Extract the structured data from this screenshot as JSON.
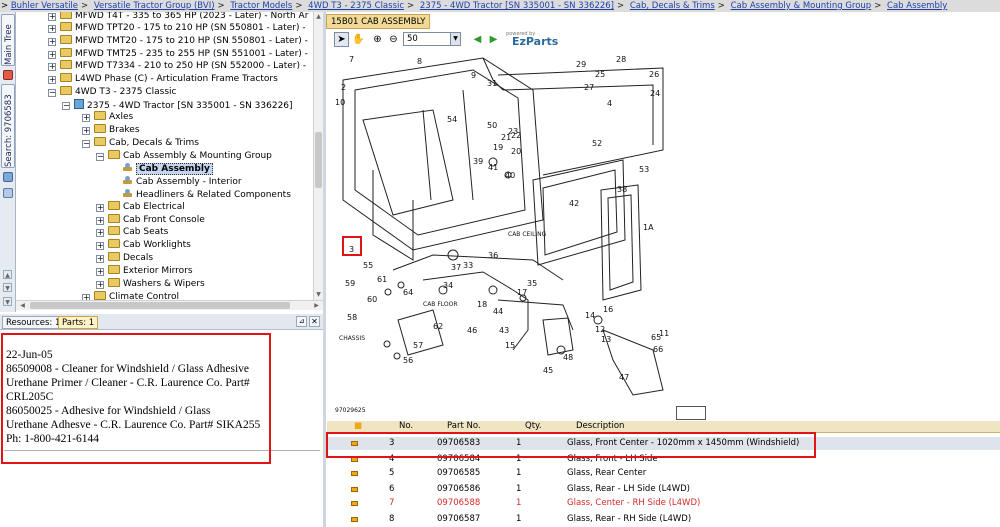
{
  "breadcrumb": {
    "items": [
      "Buhler Versatile",
      "Versatile Tractor Group (BVI)",
      "Tractor Models",
      "4WD T3 - 2375 Classic",
      "2375 - 4WD Tractor [SN 335001 - SN 336226]",
      "Cab, Decals & Trims",
      "Cab Assembly & Mounting Group",
      "Cab Assembly"
    ],
    "separator": ">"
  },
  "side_tabs": {
    "main_tree": "Main Tree",
    "search": "Search: 9706583"
  },
  "tree": {
    "nodes": [
      {
        "text": "MFWD T4T - 335 to 365 HP (2023 - Later) - North Ar",
        "icon": "folder-icon"
      },
      {
        "text": "MFWD TPT20 - 175 to 210 HP (SN 550801 - Later) -",
        "icon": "folder-icon"
      },
      {
        "text": "MFWD TMT20 - 175 to 210 HP (SN 550801 - Later) -",
        "icon": "folder-icon"
      },
      {
        "text": "MFWD TMT25 - 235 to 255 HP (SN 551001 - Later) -",
        "icon": "folder-icon"
      },
      {
        "text": "MFWD T7334 - 210 to 250 HP (SN 552000 - Later) -",
        "icon": "folder-icon"
      },
      {
        "text": "L4WD Phase (C) - Articulation Frame Tractors",
        "icon": "folder-icon"
      },
      {
        "text": "4WD T3 - 2375 Classic",
        "icon": "folder-icon"
      },
      {
        "text": "2375 - 4WD Tractor [SN 335001 - SN 336226]",
        "icon": "document-icon"
      },
      {
        "text": "Axles",
        "icon": "folder-icon"
      },
      {
        "text": "Brakes",
        "icon": "folder-icon"
      },
      {
        "text": "Cab, Decals & Trims",
        "icon": "folder-icon"
      },
      {
        "text": "Cab Assembly & Mounting Group",
        "icon": "folder-icon"
      },
      {
        "text": "Cab Assembly",
        "icon": "picture-icon",
        "selected": true
      },
      {
        "text": "Cab Assembly - Interior",
        "icon": "picture-icon"
      },
      {
        "text": "Headliners & Related Components",
        "icon": "picture-icon"
      },
      {
        "text": "Cab Electrical",
        "icon": "folder-icon"
      },
      {
        "text": "Cab Front Console",
        "icon": "folder-icon"
      },
      {
        "text": "Cab Seats",
        "icon": "folder-icon"
      },
      {
        "text": "Cab Worklights",
        "icon": "folder-icon"
      },
      {
        "text": "Decals",
        "icon": "folder-icon"
      },
      {
        "text": "Exterior Mirrors",
        "icon": "folder-icon"
      },
      {
        "text": "Washers & Wipers",
        "icon": "folder-icon"
      },
      {
        "text": "Climate Control",
        "icon": "folder-icon"
      }
    ]
  },
  "bottom_tabs": {
    "resources": "Resources: 1",
    "parts": "Parts: 1"
  },
  "notes": {
    "lines": [
      "22-Jun-05",
      "86509008 - Cleaner for Windshield / Glass Adhesive",
      "Urethane Primer / Cleaner - C.R. Laurence Co. Part#",
      "CRL205C",
      "86050025 - Adhesive for Windshield / Glass",
      "Urethane Adhesve - C.R. Laurence Co. Part# SIKA255",
      "Ph: 1-800-421-6144"
    ]
  },
  "diagram_tab": {
    "label": "15B01 CAB ASSEMBLY"
  },
  "toolbar": {
    "zoom": "50",
    "brand_small": "powered by",
    "brand": "EzParts"
  },
  "diagram": {
    "code": "97029625",
    "callouts": [
      "7",
      "8",
      "2",
      "10",
      "3",
      "9",
      "31",
      "54",
      "50",
      "19",
      "21",
      "39",
      "41",
      "40",
      "20",
      "23",
      "28",
      "29",
      "25",
      "27",
      "26",
      "24",
      "4",
      "22",
      "52",
      "53",
      "38",
      "42",
      "1A",
      "36",
      "37",
      "35",
      "59",
      "61",
      "60",
      "64",
      "34",
      "33",
      "18",
      "17",
      "16",
      "14",
      "12",
      "11",
      "13",
      "15",
      "44",
      "43",
      "45",
      "46",
      "58",
      "62",
      "57",
      "56",
      "55",
      "65",
      "66",
      "48",
      "47"
    ],
    "labels": {
      "cab_ceiling": "CAB CEILING",
      "cab_floor": "CAB FLOOR",
      "chassis": "CHASSIS"
    },
    "highlighted_callout": "3"
  },
  "parts_table": {
    "headers": [
      "No.",
      "Part No.",
      "Qty.",
      "Description"
    ],
    "rows": [
      {
        "no": "3",
        "part": "09706583",
        "qty": "1",
        "desc": "Glass, Front Center - 1020mm x 1450mm (Windshield)",
        "highlight": true
      },
      {
        "no": "4",
        "part": "09706584",
        "qty": "1",
        "desc": "Glass, Front - LH Side"
      },
      {
        "no": "5",
        "part": "09706585",
        "qty": "1",
        "desc": "Glass, Rear Center"
      },
      {
        "no": "6",
        "part": "09706586",
        "qty": "1",
        "desc": "Glass, Rear - LH Side (L4WD)"
      },
      {
        "no": "7",
        "part": "09706588",
        "qty": "1",
        "desc": "Glass, Center - RH Side (L4WD)",
        "red": true
      },
      {
        "no": "8",
        "part": "09706587",
        "qty": "1",
        "desc": "Glass, Rear - RH Side (L4WD)"
      }
    ]
  },
  "colors": {
    "accent_red": "#e01414",
    "link_blue": "#1f3fa8",
    "tab_gold": "#f3d996",
    "red_text": "#d42a2a"
  }
}
